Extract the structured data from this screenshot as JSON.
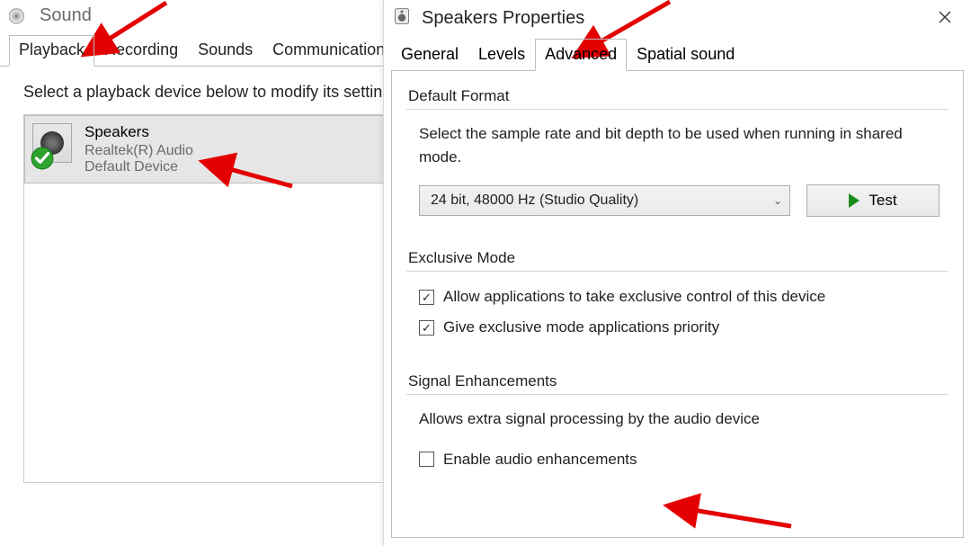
{
  "sound": {
    "title": "Sound",
    "tabs": [
      "Playback",
      "Recording",
      "Sounds",
      "Communications"
    ],
    "active_tab": 0,
    "instruction": "Select a playback device below to modify its settin",
    "device": {
      "name": "Speakers",
      "driver": "Realtek(R) Audio",
      "status": "Default Device"
    }
  },
  "props": {
    "title": "Speakers Properties",
    "tabs": [
      "General",
      "Levels",
      "Advanced",
      "Spatial sound"
    ],
    "active_tab": 2,
    "default_format": {
      "label": "Default Format",
      "desc": "Select the sample rate and bit depth to be used when running in shared mode.",
      "selected": "24 bit, 48000 Hz (Studio Quality)",
      "test_label": "Test"
    },
    "exclusive": {
      "label": "Exclusive Mode",
      "opt1": "Allow applications to take exclusive control of this device",
      "opt1_checked": true,
      "opt2": "Give exclusive mode applications priority",
      "opt2_checked": true
    },
    "signal": {
      "label": "Signal Enhancements",
      "desc": "Allows extra signal processing by the audio device",
      "opt": "Enable audio enhancements",
      "opt_checked": false
    }
  }
}
